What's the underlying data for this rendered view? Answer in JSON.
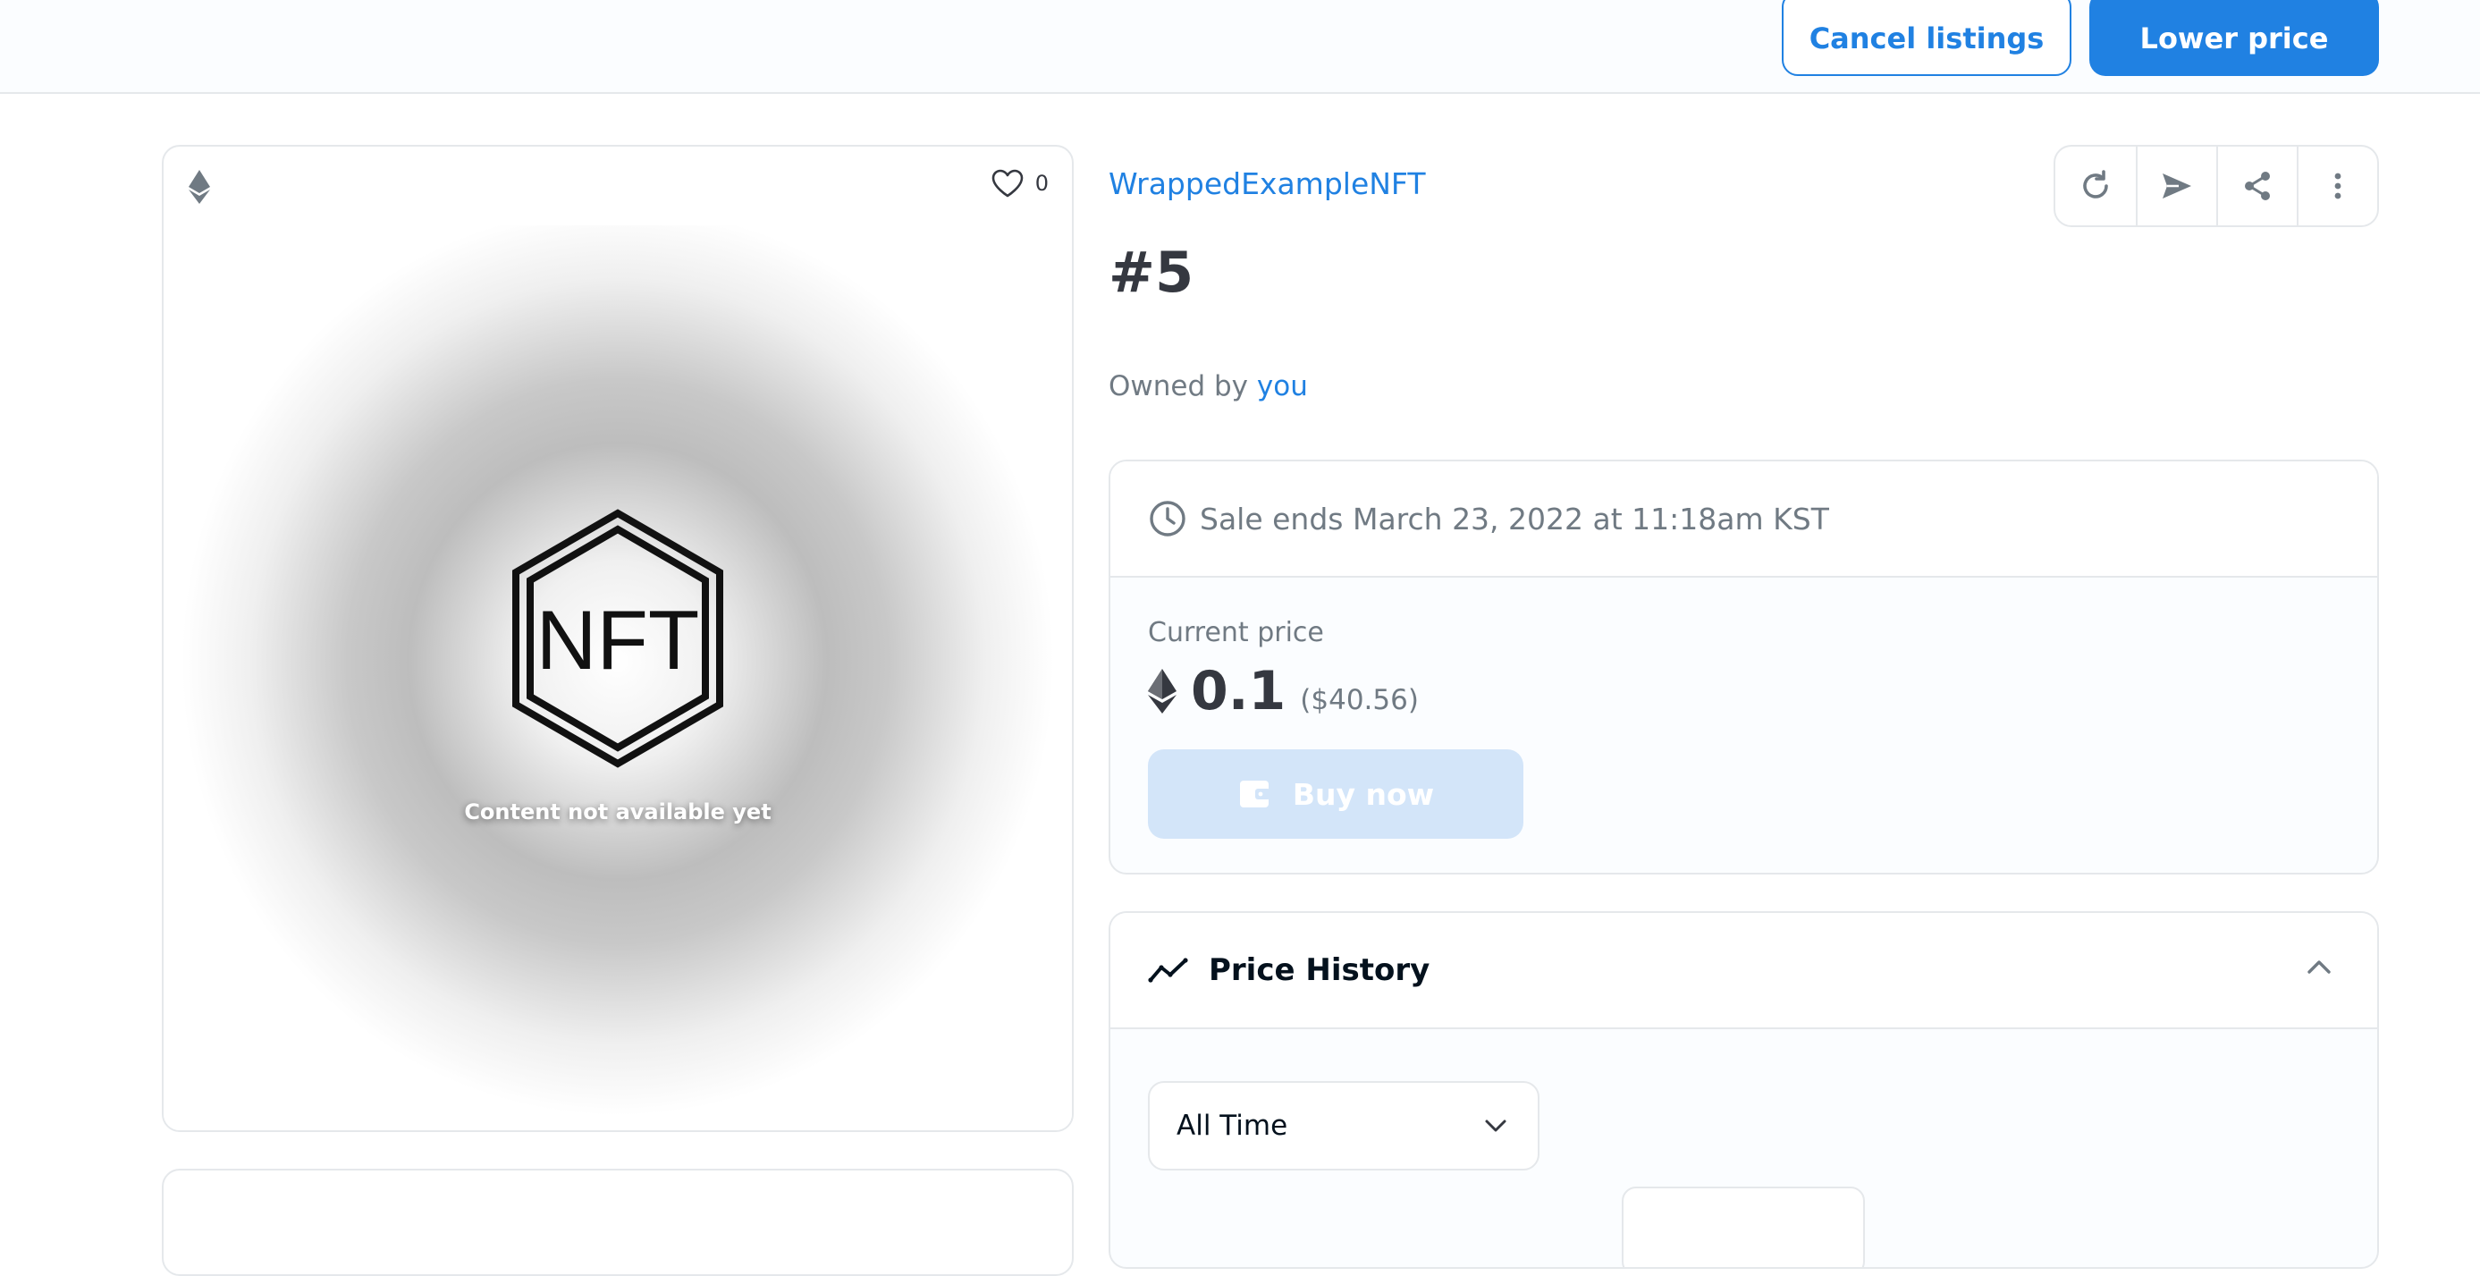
{
  "toolbar": {
    "cancel_label": "Cancel listings",
    "lower_label": "Lower price"
  },
  "media": {
    "like_count": "0",
    "placeholder_text": "Content not available yet",
    "logo_text": "NFT"
  },
  "item": {
    "collection": "WrappedExampleNFT",
    "title": "#5",
    "owned_prefix": "Owned by",
    "owner": "you"
  },
  "actions": [
    "refresh-icon",
    "transfer-icon",
    "share-icon",
    "more-icon"
  ],
  "sale": {
    "ends_text": "Sale ends March 23, 2022 at 11:18am KST",
    "price_label": "Current price",
    "price": "0.1",
    "price_usd": "($40.56)",
    "buy_label": "Buy now"
  },
  "price_history": {
    "title": "Price History",
    "range_selected": "All Time"
  },
  "colors": {
    "accent": "#2081e2",
    "text": "#353840",
    "muted": "#707a83",
    "border": "#e5e8eb",
    "disabled_button": "#d3e5f9"
  }
}
